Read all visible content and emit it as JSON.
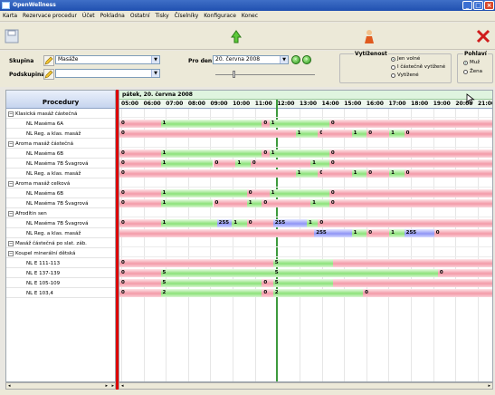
{
  "window": {
    "title": "OpenWellness"
  },
  "menu": [
    "Karta",
    "Rezervace procedur",
    "Účet",
    "Pokladna",
    "Ostatní",
    "Tisky",
    "Číselníky",
    "Konfigurace",
    "Konec"
  ],
  "filters": {
    "skupina_label": "Skupina",
    "skupina_value": "Masáže",
    "podskupina_label": "Podskupina",
    "podskupina_value": "",
    "pro_den_label": "Pro den",
    "date_value": "20. června 2008"
  },
  "vytizenost": {
    "title": "Vytíženost",
    "options": [
      "Jen volné",
      "I částečně vytížené",
      "Vytížené"
    ],
    "selected": 0
  },
  "pohlavi": {
    "title": "Pohlaví",
    "options": [
      "Muž",
      "Žena"
    ],
    "selected": 0
  },
  "procedures_header": "Procedury",
  "date_header": "pátek, 20. června 2008",
  "time_labels": [
    "05:00",
    "06:00",
    "07:00",
    "08:00",
    "09:00",
    "10:00",
    "11:00",
    "12:00",
    "13:00",
    "14:00",
    "15:00",
    "16:00",
    "17:00",
    "18:00",
    "19:00",
    "20:00",
    "21:00"
  ],
  "procedures": [
    {
      "label": "Klasická masáž částečná",
      "group": true,
      "segs": []
    },
    {
      "label": "NL Maséma 6A",
      "group": false,
      "segs": [
        [
          "red",
          0,
          11,
          "0"
        ],
        [
          "green",
          11,
          38,
          "1"
        ],
        [
          "red",
          38,
          40,
          "0"
        ],
        [
          "green",
          40,
          56,
          "1"
        ],
        [
          "red",
          56,
          100,
          "0"
        ]
      ]
    },
    {
      "label": "NL Reg. a klas. masáž",
      "group": false,
      "segs": [
        [
          "red",
          0,
          47,
          "0"
        ],
        [
          "green",
          47,
          53,
          "1"
        ],
        [
          "red",
          53,
          54,
          "0"
        ],
        [
          "red",
          54,
          62,
          ""
        ],
        [
          "green",
          62,
          66,
          "1"
        ],
        [
          "red",
          66,
          72,
          "0"
        ],
        [
          "green",
          72,
          76,
          "1"
        ],
        [
          "red",
          76,
          100,
          "0"
        ]
      ]
    },
    {
      "label": "Aroma masáž částečná",
      "group": true,
      "segs": []
    },
    {
      "label": "NL Maséma 6B",
      "group": false,
      "segs": [
        [
          "red",
          0,
          11,
          "0"
        ],
        [
          "green",
          11,
          38,
          "1"
        ],
        [
          "red",
          38,
          40,
          "0"
        ],
        [
          "green",
          40,
          56,
          "1"
        ],
        [
          "red",
          56,
          100,
          "0"
        ]
      ]
    },
    {
      "label": "NL Maséma 7B Švagrová",
      "group": false,
      "segs": [
        [
          "red",
          0,
          11,
          "0"
        ],
        [
          "green",
          11,
          25,
          "1"
        ],
        [
          "red",
          25,
          31,
          "0"
        ],
        [
          "green",
          31,
          35,
          "1"
        ],
        [
          "red",
          35,
          51,
          "0"
        ],
        [
          "green",
          51,
          56,
          "1"
        ],
        [
          "red",
          56,
          100,
          "0"
        ]
      ]
    },
    {
      "label": "NL Reg. a klas. masáž",
      "group": false,
      "segs": [
        [
          "red",
          0,
          47,
          "0"
        ],
        [
          "green",
          47,
          53,
          "1"
        ],
        [
          "red",
          53,
          54,
          "0"
        ],
        [
          "red",
          54,
          62,
          ""
        ],
        [
          "green",
          62,
          66,
          "1"
        ],
        [
          "red",
          66,
          72,
          "0"
        ],
        [
          "green",
          72,
          76,
          "1"
        ],
        [
          "red",
          76,
          100,
          "0"
        ]
      ]
    },
    {
      "label": "Aroma masáž celková",
      "group": true,
      "segs": []
    },
    {
      "label": "NL Maséma 6B",
      "group": false,
      "segs": [
        [
          "red",
          0,
          11,
          "0"
        ],
        [
          "green",
          11,
          34,
          "1"
        ],
        [
          "red",
          34,
          40,
          "0"
        ],
        [
          "green",
          40,
          56,
          "1"
        ],
        [
          "red",
          56,
          100,
          "0"
        ]
      ]
    },
    {
      "label": "NL Maséma 7B Švagrová",
      "group": false,
      "segs": [
        [
          "red",
          0,
          11,
          "0"
        ],
        [
          "green",
          11,
          25,
          "1"
        ],
        [
          "red",
          25,
          34,
          "0"
        ],
        [
          "green",
          34,
          38,
          "1"
        ],
        [
          "red",
          38,
          51,
          "0"
        ],
        [
          "green",
          51,
          56,
          "1"
        ],
        [
          "red",
          56,
          100,
          "0"
        ]
      ]
    },
    {
      "label": "Afrodítin sen",
      "group": true,
      "segs": []
    },
    {
      "label": "NL Maséma 7B Švagrová",
      "group": false,
      "segs": [
        [
          "red",
          0,
          11,
          "0"
        ],
        [
          "green",
          11,
          26,
          "1"
        ],
        [
          "blue",
          26,
          30,
          "255"
        ],
        [
          "green",
          30,
          34,
          "1"
        ],
        [
          "red",
          34,
          41,
          "0"
        ],
        [
          "blue",
          41,
          50,
          "255"
        ],
        [
          "green",
          50,
          53,
          "1"
        ],
        [
          "red",
          53,
          100,
          "0"
        ]
      ]
    },
    {
      "label": "NL Reg. a klas. masáž",
      "group": false,
      "segs": [
        [
          "red",
          0,
          52,
          ""
        ],
        [
          "blue",
          52,
          62,
          "255"
        ],
        [
          "green",
          62,
          66,
          "1"
        ],
        [
          "red",
          66,
          72,
          "0"
        ],
        [
          "green",
          72,
          76,
          "1"
        ],
        [
          "blue",
          76,
          84,
          "255"
        ],
        [
          "red",
          84,
          100,
          "0"
        ]
      ]
    },
    {
      "label": "Masáž částečná po slat. záb.",
      "group": true,
      "segs": []
    },
    {
      "label": "Koupel minerální dětská",
      "group": true,
      "segs": []
    },
    {
      "label": "NL E 111-113",
      "group": false,
      "segs": [
        [
          "red",
          0,
          41,
          "0"
        ],
        [
          "green",
          41,
          57,
          "5"
        ],
        [
          "red",
          57,
          100,
          ""
        ]
      ]
    },
    {
      "label": "NL E 137-139",
      "group": false,
      "segs": [
        [
          "red",
          0,
          11,
          "0"
        ],
        [
          "green",
          11,
          41,
          "5"
        ],
        [
          "red",
          41,
          41,
          ""
        ],
        [
          "green",
          41,
          85,
          "5"
        ],
        [
          "red",
          85,
          100,
          "0"
        ]
      ]
    },
    {
      "label": "NL E 105-109",
      "group": false,
      "segs": [
        [
          "red",
          0,
          11,
          "0"
        ],
        [
          "green",
          11,
          38,
          "5"
        ],
        [
          "red",
          38,
          41,
          "0"
        ],
        [
          "green",
          41,
          57,
          "5"
        ],
        [
          "red",
          57,
          100,
          ""
        ]
      ]
    },
    {
      "label": "NL E 103,4",
      "group": false,
      "segs": [
        [
          "red",
          0,
          11,
          "0"
        ],
        [
          "green",
          11,
          38,
          "2"
        ],
        [
          "red",
          38,
          41,
          "0"
        ],
        [
          "green",
          41,
          65,
          "2"
        ],
        [
          "red",
          65,
          100,
          "0"
        ]
      ]
    }
  ]
}
